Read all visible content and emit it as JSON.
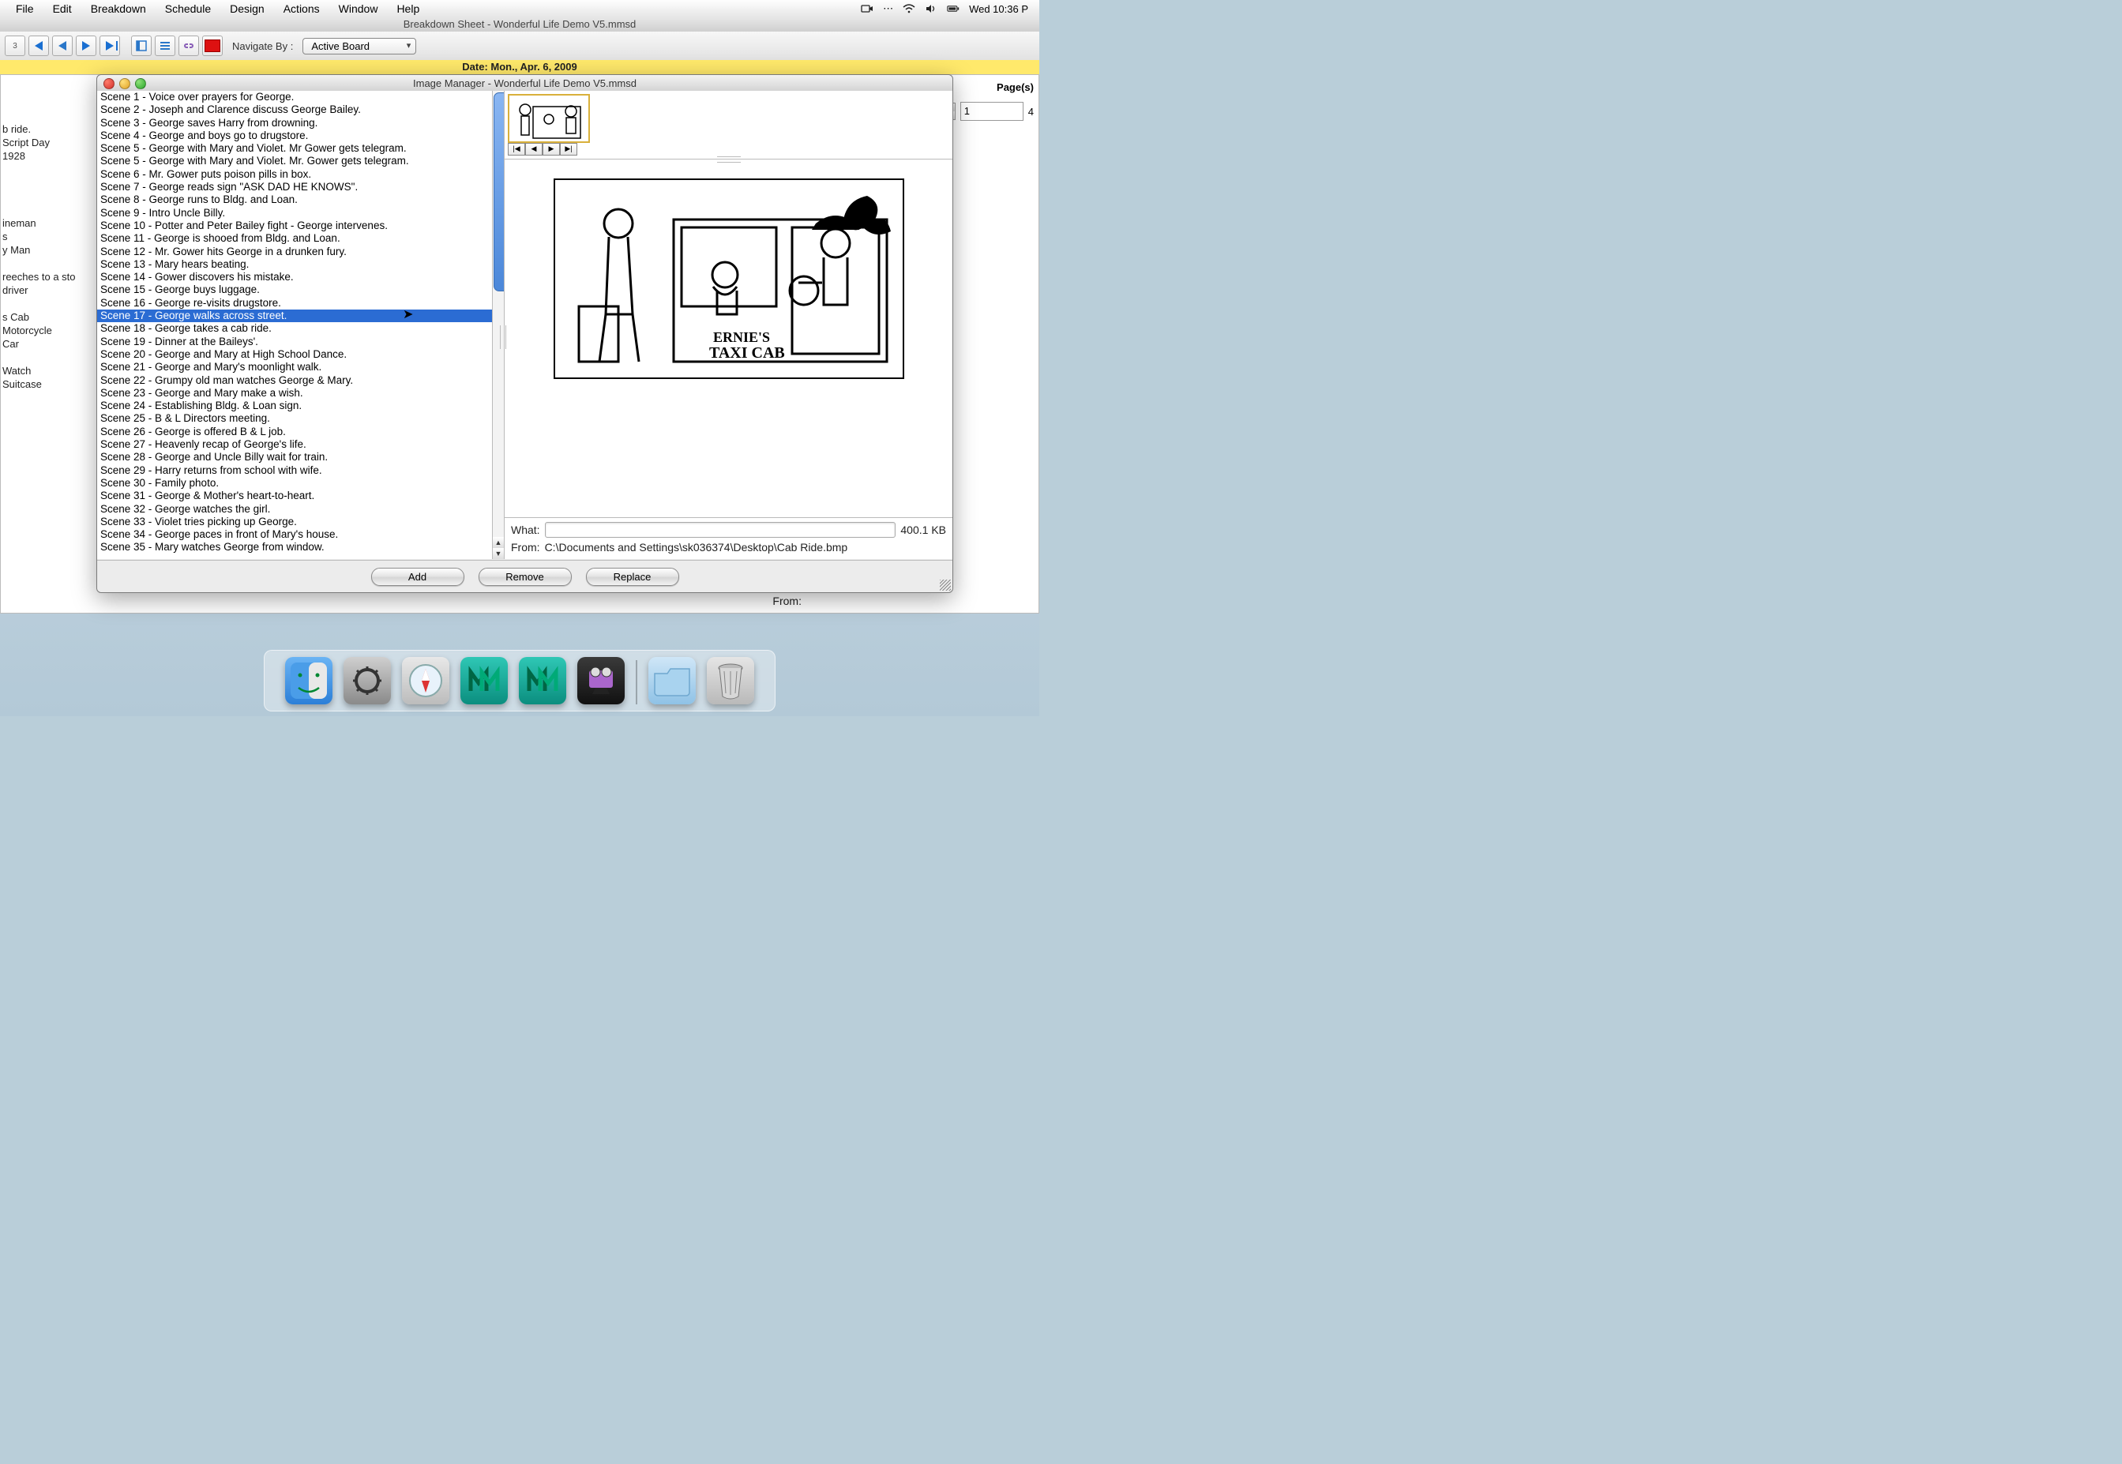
{
  "menubar": {
    "items": [
      "File",
      "Edit",
      "Breakdown",
      "Schedule",
      "Design",
      "Actions",
      "Window",
      "Help"
    ],
    "clock": "Wed 10:36 P"
  },
  "document_title": "Breakdown Sheet - Wonderful Life Demo V5.mmsd",
  "toolbar": {
    "navigate_label": "Navigate By :",
    "combo_value": "Active Board"
  },
  "date_strip": "Date: Mon., Apr. 6, 2009",
  "bg_sheet": {
    "left_lines": [
      "b ride.",
      "Script Day",
      "1928",
      "",
      "",
      "",
      "",
      "ineman",
      "s",
      "y Man",
      "",
      "reeches to a sto",
      "driver",
      "",
      "s Cab",
      "Motorcycle",
      "Car",
      "",
      "    Watch",
      "Suitcase"
    ],
    "pages_label": "Page(s)",
    "pages_value": "1",
    "pages_right": "4",
    "what_label": "What:",
    "from_label": "From:"
  },
  "image_manager": {
    "title": "Image Manager - Wonderful Life Demo V5.mmsd",
    "selected_index": 17,
    "scenes": [
      "Scene 1 - Voice over prayers for George.",
      "Scene 2 - Joseph and Clarence discuss George Bailey.",
      "Scene 3 - George saves Harry from drowning.",
      "Scene 4 - George and boys go to drugstore.",
      "Scene 5 - George with Mary and Violet. Mr Gower gets telegram.",
      "Scene 5 - George with Mary and Violet. Mr. Gower gets telegram.",
      "Scene 6 - Mr. Gower puts poison pills in box.",
      "Scene 7 - George reads sign \"ASK DAD HE KNOWS\".",
      "Scene 8 - George runs to Bldg. and Loan.",
      "Scene 9 - Intro Uncle Billy.",
      "Scene 10 - Potter and Peter Bailey fight - George intervenes.",
      "Scene 11 - George is shooed from Bldg. and Loan.",
      "Scene 12 - Mr. Gower hits George in a drunken fury.",
      "Scene 13 - Mary hears beating.",
      "Scene 14 - Gower discovers his mistake.",
      "Scene 15 - George buys luggage.",
      "Scene 16 - George re-visits drugstore.",
      "Scene 17 - George walks across street.",
      "Scene 18 - George takes a cab ride.",
      "Scene 19 - Dinner at the Baileys'.",
      "Scene 20 - George and Mary at High School Dance.",
      "Scene 21 - George and Mary's moonlight walk.",
      "Scene 22 - Grumpy old man watches George & Mary.",
      "Scene 23 - George and Mary make a wish.",
      "Scene 24 - Establishing Bldg. & Loan sign.",
      "Scene 25 - B & L Directors meeting.",
      "Scene 26 - George is offered B & L job.",
      "Scene 27 - Heavenly recap of George's life.",
      "Scene 28 - George and Uncle Billy wait for train.",
      "Scene 29 - Harry returns from school with wife.",
      "Scene 30 - Family photo.",
      "Scene 31 - George & Mother's heart-to-heart.",
      "Scene 32 - George watches the girl.",
      "Scene 33 - Violet tries picking up George.",
      "Scene 34 - George paces in front of Mary's house.",
      "Scene 35 - Mary watches George from window."
    ],
    "what_label": "What:",
    "what_value": "",
    "size": "400.1 KB",
    "from_label": "From:",
    "from_value": "C:\\Documents and Settings\\sk036374\\Desktop\\Cab Ride.bmp",
    "buttons": {
      "add": "Add",
      "remove": "Remove",
      "replace": "Replace"
    }
  }
}
